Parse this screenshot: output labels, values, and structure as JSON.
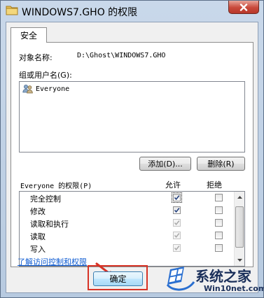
{
  "window": {
    "title": "WINDOWS7.GHO 的权限",
    "close_icon": "close-icon"
  },
  "tabs": [
    {
      "label": "安全",
      "selected": true
    }
  ],
  "object": {
    "label": "对象名称:",
    "value": "D:\\Ghost\\WINDOWS7.GHO"
  },
  "groups": {
    "label": "组或用户名(G):",
    "items": [
      {
        "label": "Everyone",
        "icon": "users-icon"
      }
    ]
  },
  "buttons": {
    "add": "添加(D)...",
    "remove": "删除(R)",
    "ok": "确定"
  },
  "permissions": {
    "header": "Everyone 的权限(P)",
    "allow_label": "允许",
    "deny_label": "拒绝",
    "rows": [
      {
        "name": "完全控制",
        "allow": true,
        "deny": false,
        "enabled": true
      },
      {
        "name": "修改",
        "allow": true,
        "deny": false,
        "enabled": true
      },
      {
        "name": "读取和执行",
        "allow": true,
        "deny": false,
        "enabled": false
      },
      {
        "name": "读取",
        "allow": true,
        "deny": false,
        "enabled": false
      },
      {
        "name": "写入",
        "allow": true,
        "deny": false,
        "enabled": false
      }
    ]
  },
  "link": {
    "label": "了解访问控制和权限"
  },
  "annotation": {
    "color": "#d73326"
  },
  "watermark": {
    "name": "系统之家",
    "domain": "Win10net.com"
  }
}
